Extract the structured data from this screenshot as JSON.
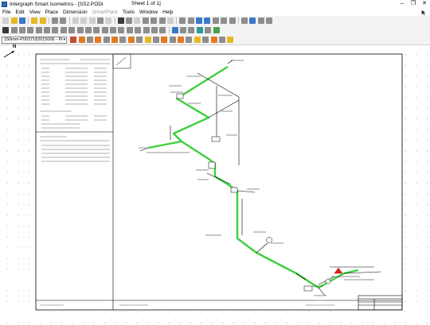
{
  "window": {
    "title": "Intergraph Smart Isometrics - [SS2.PODi",
    "sheet": "Sheet 1 of 1]",
    "controls": [
      "–",
      "❐",
      "✕"
    ]
  },
  "menu": {
    "items": [
      {
        "label": "File",
        "enabled": true
      },
      {
        "label": "Edit",
        "enabled": true
      },
      {
        "label": "View",
        "enabled": true
      },
      {
        "label": "Place",
        "enabled": true
      },
      {
        "label": "Dimension",
        "enabled": true
      },
      {
        "label": "SmartPlant",
        "enabled": false
      },
      {
        "label": "Tools",
        "enabled": true
      },
      {
        "label": "Window",
        "enabled": true
      },
      {
        "label": "Help",
        "enabled": true
      }
    ]
  },
  "toolbar": {
    "sheet_selector": "150mm-P0037182015006 - Pr"
  },
  "canvas": {
    "north_label": "N",
    "colors": {
      "pipe": "#3bd13b",
      "border": "#000000",
      "grid_dot": "#b8b8b8",
      "marker": "#e02020"
    }
  }
}
